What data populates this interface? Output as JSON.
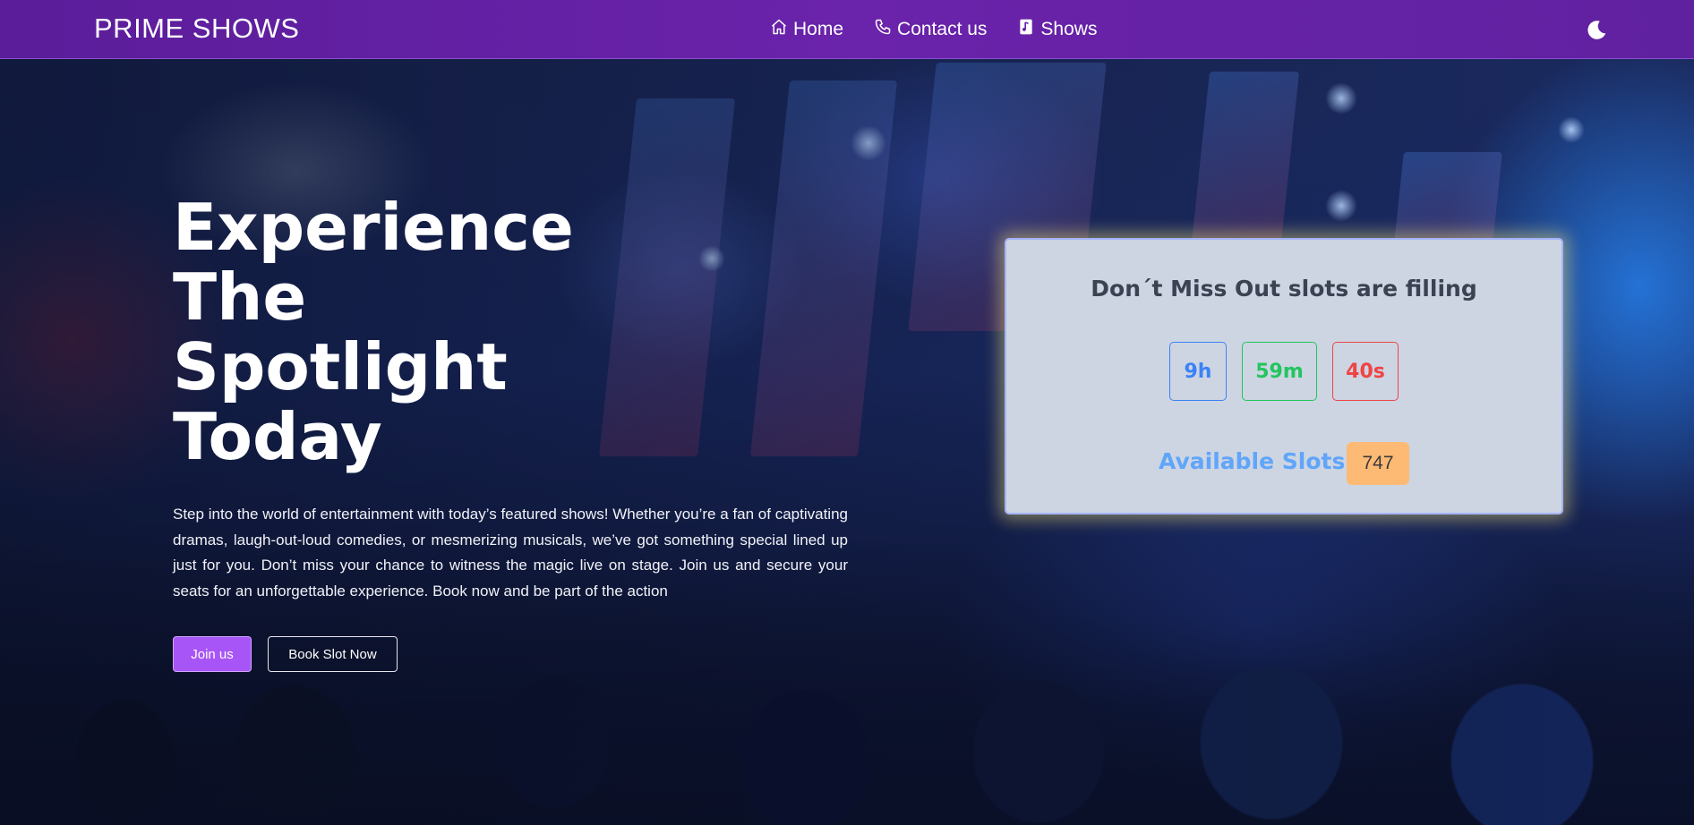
{
  "nav": {
    "brand": "PRIME SHOWS",
    "links": [
      {
        "label": "Home",
        "icon": "home-icon"
      },
      {
        "label": "Contact us",
        "icon": "phone-icon"
      },
      {
        "label": "Shows",
        "icon": "music-note-icon"
      }
    ],
    "theme_icon": "moon-icon",
    "color": "#6a23ab"
  },
  "hero": {
    "headline_lines": [
      "Experience",
      "The",
      "Spotlight",
      "Today"
    ],
    "description": "Step into the world of entertainment with today’s featured shows! Whether you’re a fan of captivating dramas, laugh-out-loud comedies, or mesmerizing musicals, we’ve got something special lined up just for you. Don’t miss your chance to witness the magic live on stage. Join us and secure your seats for an unforgettable experience. Book now and be part of the action",
    "join_label": "Join us",
    "book_label": "Book Slot Now",
    "join_color": "#a855f7"
  },
  "countdown": {
    "title": "Don´t Miss Out slots are filling",
    "hours": "9h",
    "minutes": "59m",
    "seconds": "40s",
    "slots_label": "Available Slots",
    "slots_count": "747",
    "colors": {
      "hours": "#3b82f6",
      "minutes": "#22c55e",
      "seconds": "#ef4444",
      "slots_label": "#60a5fa",
      "slots_badge": "#fdba74"
    }
  }
}
